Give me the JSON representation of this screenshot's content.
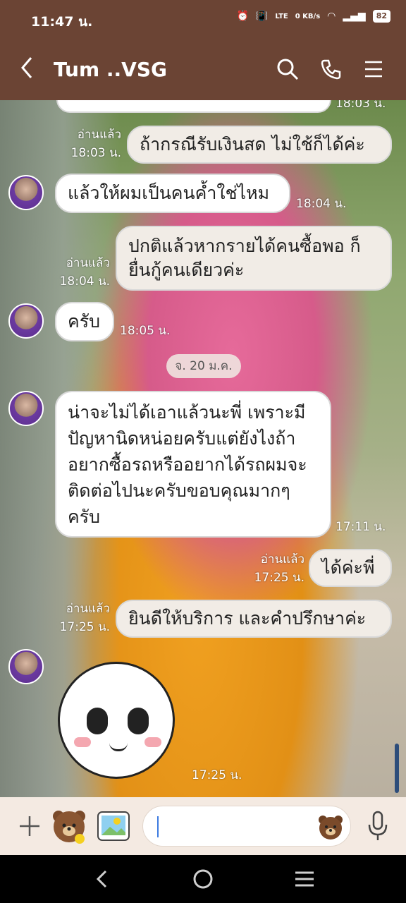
{
  "status_bar": {
    "time": "11:47 น.",
    "network": "0 KB/s",
    "battery": "82"
  },
  "header": {
    "contact_name": "Tum ..VSG"
  },
  "messages": [
    {
      "side": "mine",
      "text": "ถ้ากรณีรับเงินสด ไม่ใช้ก็ได้ค่ะ",
      "read": "อ่านแล้ว",
      "time": "18:03 น."
    },
    {
      "side": "theirs",
      "text": "แล้วให้ผมเป็นคนค้ำใช่ไหม",
      "time": "18:04 น."
    },
    {
      "side": "mine",
      "text": "ปกติแล้วหากรายได้คนซื้อพอ ก็ยื่นกู้คนเดียวค่ะ",
      "read": "อ่านแล้ว",
      "time": "18:04 น."
    },
    {
      "side": "theirs",
      "text": "ครับ",
      "time": "18:05 น."
    },
    {
      "side": "theirs",
      "text": "น่าจะไม่ได้เอาแล้วนะพี่ เพราะมีปัญหานิดหน่อยครับแต่ยังไงถ้าอยากซื้อรถหรืออยากได้รถผมจะติดต่อไปนะครับขอบคุณมากๆครับ",
      "time": "17:11 น."
    },
    {
      "side": "mine",
      "text": "ได้ค่ะพี่",
      "read": "อ่านแล้ว",
      "time": "17:25 น."
    },
    {
      "side": "mine",
      "text": "ยินดีให้บริการ และคำปรึกษาค่ะ",
      "read": "อ่านแล้ว",
      "time": "17:25 น."
    },
    {
      "side": "theirs",
      "sticker": "sad-face-sticker",
      "time": "17:25 น."
    }
  ],
  "partial_top_time": "18:03 น.",
  "date_divider": "จ. 20 ม.ค.",
  "colors": {
    "header_bg": "#6b4434",
    "input_bar_bg": "#f4eae2",
    "caret": "#3d7be0"
  }
}
